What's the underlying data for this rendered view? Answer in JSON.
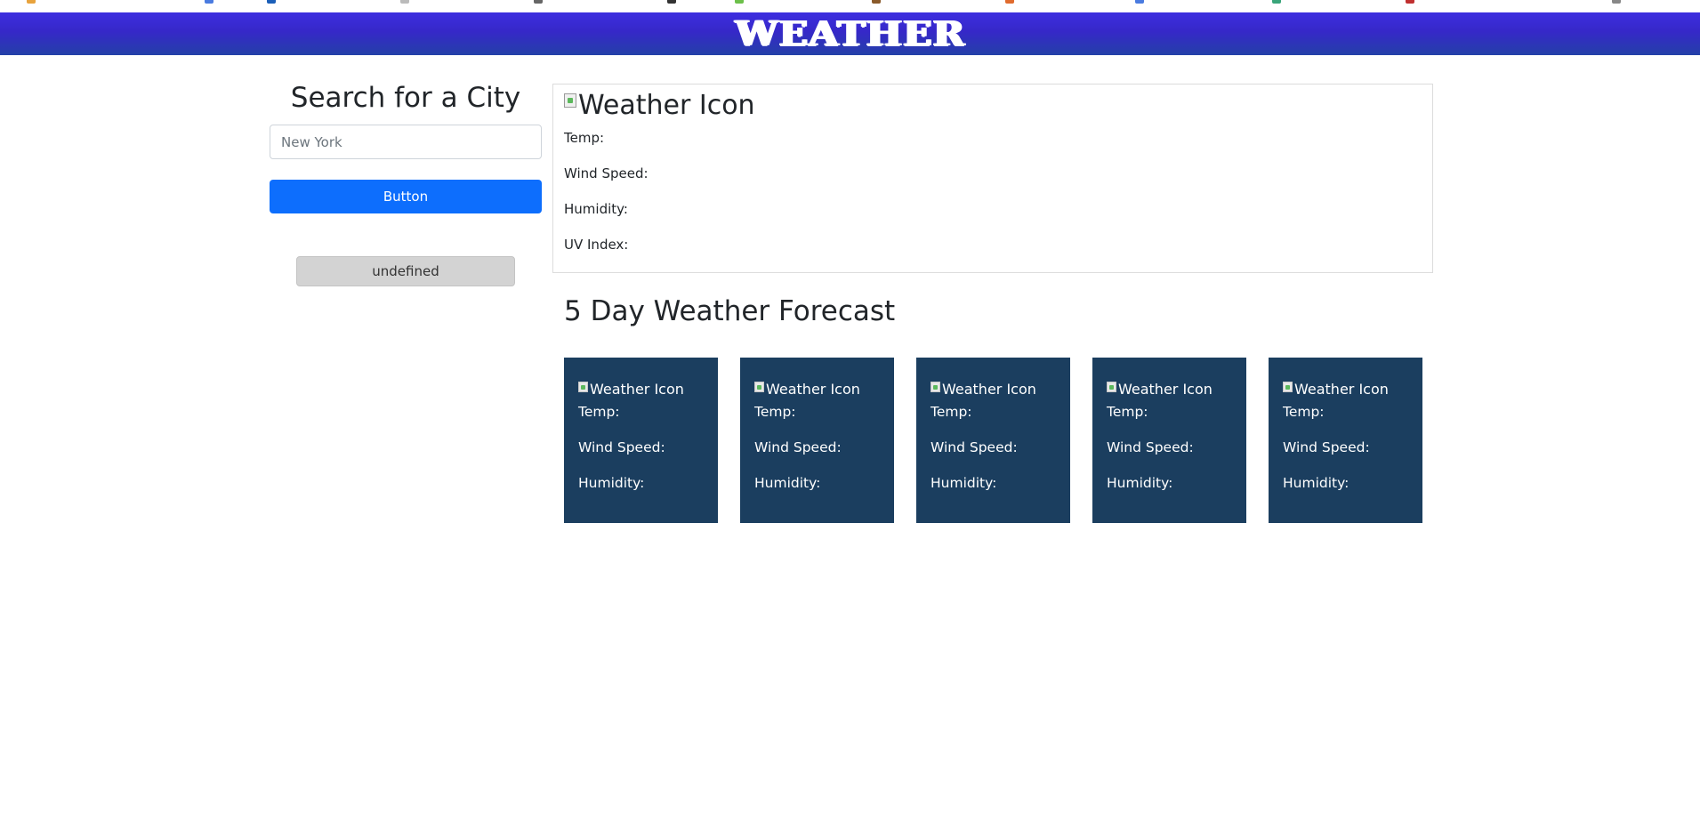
{
  "header": {
    "title": "WEATHER"
  },
  "search": {
    "title": "Search for a City",
    "placeholder": "New York",
    "button_label": "Button",
    "history": [
      "undefined"
    ]
  },
  "current": {
    "icon_alt": "Weather Icon",
    "temp_label": "Temp:",
    "wind_label": "Wind Speed:",
    "humidity_label": "Humidity:",
    "uv_label": "UV Index:"
  },
  "forecast": {
    "title": "5 Day Weather Forecast",
    "days": [
      {
        "icon_alt": "Weather Icon",
        "temp_label": "Temp:",
        "wind_label": "Wind Speed:",
        "humidity_label": "Humidity:"
      },
      {
        "icon_alt": "Weather Icon",
        "temp_label": "Temp:",
        "wind_label": "Wind Speed:",
        "humidity_label": "Humidity:"
      },
      {
        "icon_alt": "Weather Icon",
        "temp_label": "Temp:",
        "wind_label": "Wind Speed:",
        "humidity_label": "Humidity:"
      },
      {
        "icon_alt": "Weather Icon",
        "temp_label": "Temp:",
        "wind_label": "Wind Speed:",
        "humidity_label": "Humidity:"
      },
      {
        "icon_alt": "Weather Icon",
        "temp_label": "Temp:",
        "wind_label": "Wind Speed:",
        "humidity_label": "Humidity:"
      }
    ]
  },
  "colors": {
    "header_gradient_top": "#3d2ee0",
    "header_gradient_bottom": "#2440a8",
    "primary_button": "#0d6efd",
    "forecast_card": "#1b3e5f",
    "history_button": "#d3d3d3"
  }
}
